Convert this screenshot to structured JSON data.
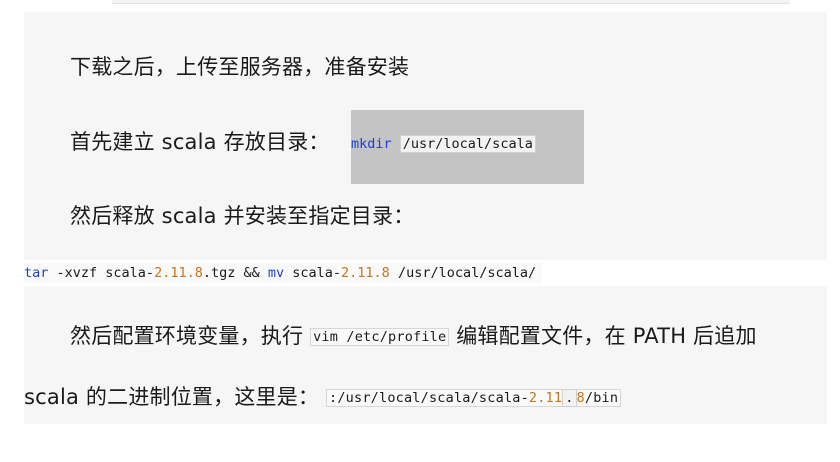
{
  "paragraphs": {
    "p1": "下载之后，上传至服务器，准备安装",
    "p2_prefix": "首先建立 scala 存放目录：",
    "p2_cmd": "mkdir",
    "p2_path": "/usr/local/scala",
    "p3": "然后释放 scala 并安装至指定目录：",
    "p4_prefix": "然后配置环境变量，执行",
    "p4_cmd": "vim /etc/profile",
    "p4_suffix": "编辑配置文件，在 PATH 后追加",
    "p5_prefix": "scala 的二进制位置，这里是：",
    "p5_path_a": ":/usr/local/scala/scala-",
    "p5_num_a": "2.11",
    "p5_dot": ".",
    "p5_num_b": "8",
    "p5_path_b": "/bin"
  },
  "command": {
    "tar": "tar",
    "flags": " -xvzf scala-",
    "ver1": "2.11.8",
    "mid": ".tgz && ",
    "mv": "mv",
    "mid2": " scala-",
    "ver2": "2.11.8",
    "dest": " /usr/local/scala/"
  },
  "colors": {
    "keyword": "#1d3ed3",
    "number": "#c8741c",
    "block_bg": "#f6f6f6",
    "highlight": "#c4c4c4"
  }
}
